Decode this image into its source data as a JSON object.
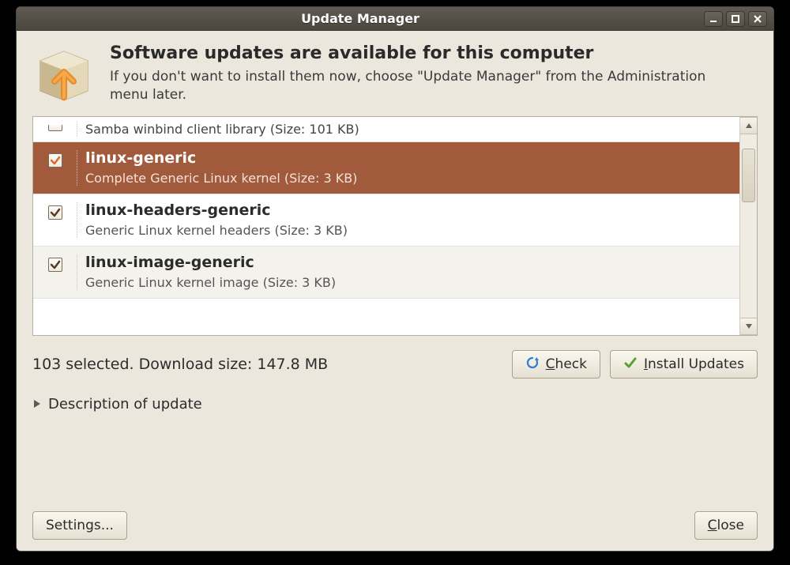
{
  "window": {
    "title": "Update Manager"
  },
  "header": {
    "headline": "Software updates are available for this computer",
    "subhead": "If you don't want to install them now, choose \"Update Manager\" from the Administration menu later."
  },
  "updates": [
    {
      "name": "",
      "description": "Samba winbind client library (Size: 101 KB)",
      "checked": true,
      "partial": true,
      "selected": false
    },
    {
      "name": "linux-generic",
      "description": "Complete Generic Linux kernel (Size: 3 KB)",
      "checked": true,
      "selected": true
    },
    {
      "name": "linux-headers-generic",
      "description": "Generic Linux kernel headers (Size: 3 KB)",
      "checked": true,
      "selected": false
    },
    {
      "name": "linux-image-generic",
      "description": "Generic Linux kernel image (Size: 3 KB)",
      "checked": true,
      "selected": false,
      "alt": true
    }
  ],
  "status": {
    "text": "103 selected. Download size: 147.8 MB"
  },
  "buttons": {
    "check": "Check",
    "install": "Install Updates",
    "settings": "Settings...",
    "close": "Close"
  },
  "expander": {
    "label": "Description of update"
  }
}
